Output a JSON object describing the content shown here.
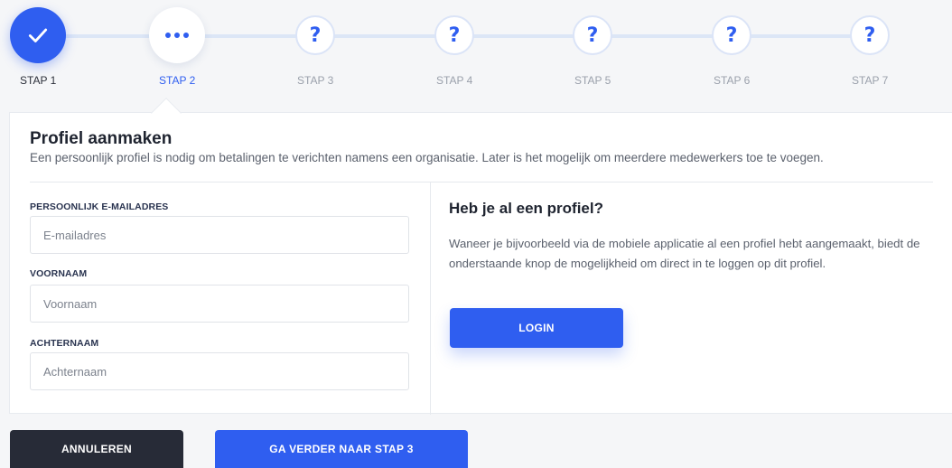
{
  "stepper": {
    "steps": [
      {
        "label": "STAP 1",
        "state": "done"
      },
      {
        "label": "STAP 2",
        "state": "active",
        "symbol": "•••"
      },
      {
        "label": "STAP 3",
        "state": "pending",
        "symbol": "?"
      },
      {
        "label": "STAP 4",
        "state": "pending",
        "symbol": "?"
      },
      {
        "label": "STAP 5",
        "state": "pending",
        "symbol": "?"
      },
      {
        "label": "STAP 6",
        "state": "pending",
        "symbol": "?"
      },
      {
        "label": "STAP 7",
        "state": "pending",
        "symbol": "?"
      }
    ]
  },
  "card": {
    "title": "Profiel aanmaken",
    "description": "Een persoonlijk profiel is nodig om betalingen te verichten namens een organisatie. Later is het mogelijk om meerdere medewerkers toe te voegen."
  },
  "form": {
    "email_label": "PERSOONLIJK E-MAILADRES",
    "email_placeholder": "E-mailadres",
    "first_name_label": "VOORNAAM",
    "first_name_placeholder": "Voornaam",
    "last_name_label": "ACHTERNAAM",
    "last_name_placeholder": "Achternaam"
  },
  "existing_profile": {
    "title": "Heb je al een profiel?",
    "text": "Waneer je bijvoorbeeld via de mobiele applicatie al een profiel hebt aangemaakt, biedt de onderstaande knop de mogelijkheid om direct in te loggen op dit profiel.",
    "login_label": "LOGIN"
  },
  "footer": {
    "cancel_label": "ANNULEREN",
    "next_label": "GA VERDER NAAR STAP 3"
  },
  "colors": {
    "primary": "#2f5ef0",
    "dark": "#272b37",
    "track": "#dce6f6"
  }
}
